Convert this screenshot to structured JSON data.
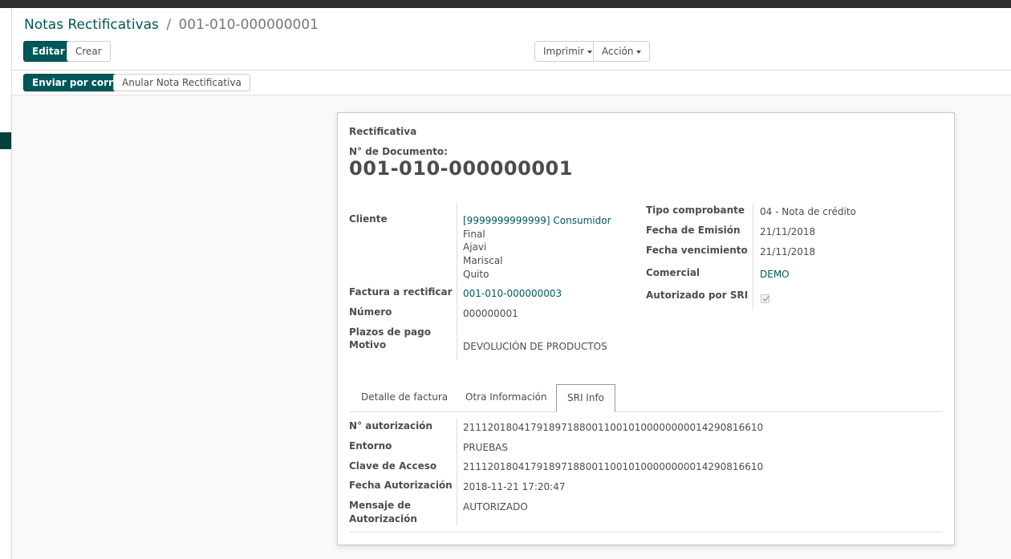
{
  "breadcrumb": {
    "parent": "Notas Rectificativas",
    "separator": "/",
    "current": "001-010-000000001"
  },
  "toolbar": {
    "edit_label": "Editar",
    "create_label": "Crear",
    "print_label": "Imprimir",
    "action_label": "Acción"
  },
  "statusbar": {
    "send_email_label": "Enviar por correo",
    "cancel_label": "Anular Nota Rectificativa"
  },
  "form": {
    "type_title": "Rectificativa",
    "doc_number_label": "N° de Documento:",
    "doc_number": "001-010-000000001",
    "left_fields": {
      "cliente_label": "Cliente",
      "cliente_lines": [
        "[9999999999999] Consumidor",
        "Final",
        "Ajavi",
        "Mariscal",
        "Quito"
      ],
      "factura_label": "Factura a rectificar",
      "factura_value": "001-010-000000003",
      "numero_label": "Número",
      "numero_value": "000000001",
      "plazos_label": "Plazos de pago",
      "motivo_label": "Motivo",
      "motivo_value": "DEVOLUCIÓN DE PRODUCTOS"
    },
    "right_fields": {
      "tipo_label": "Tipo comprobante",
      "tipo_value": "04 - Nota de crédito",
      "fecha_emision_label": "Fecha de Emisión",
      "fecha_emision_value": "21/11/2018",
      "fecha_venc_label": "Fecha vencimiento",
      "fecha_venc_value": "21/11/2018",
      "comercial_label": "Comercial",
      "comercial_value": "DEMO",
      "autorizado_label": "Autorizado por SRI",
      "autorizado_checked": true
    },
    "tabs": [
      {
        "label": "Detalle de factura",
        "active": false
      },
      {
        "label": "Otra Información",
        "active": false
      },
      {
        "label": "SRI Info",
        "active": true
      }
    ],
    "sri_info": {
      "autorizacion_label": "N° autorización",
      "autorizacion_value": "2111201804179189718800110010100000000014290816610",
      "entorno_label": "Entorno",
      "entorno_value": "PRUEBAS",
      "clave_label": "Clave de Acceso",
      "clave_value": "2111201804179189718800110010100000000014290816610",
      "fecha_aut_label": "Fecha Autorización",
      "fecha_aut_value": "2018-11-21 17:20:47",
      "mensaje_label_line1": "Mensaje de",
      "mensaje_label_line2": "Autorización",
      "mensaje_value": "AUTORIZADO"
    }
  },
  "colors": {
    "brand": "#00575a",
    "link": "#01565a",
    "topbar": "#2f2f2f"
  }
}
